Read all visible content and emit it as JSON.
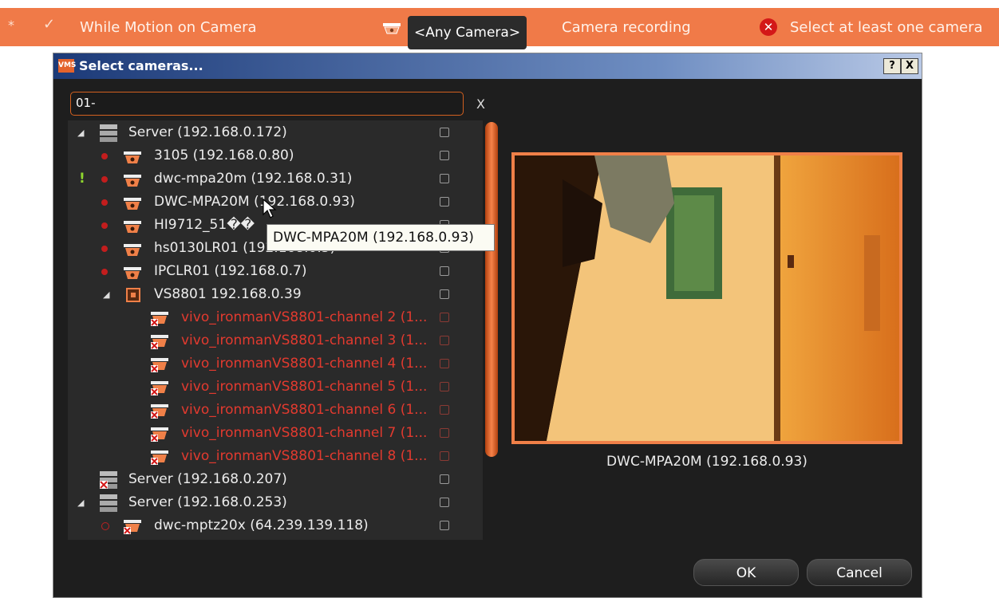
{
  "rule_bar": {
    "star": "*",
    "check": "✓",
    "condition": "While Motion on Camera",
    "camera_selector": "<Any Camera>",
    "action": "Camera recording",
    "error": "Select at least one camera"
  },
  "dialog": {
    "app_icon": "VMS",
    "title": "Select cameras...",
    "help_label": "?",
    "close_label": "X",
    "search_value": "01-",
    "clear_label": "X",
    "tree": [
      {
        "label": "Server (192.168.0.172)",
        "kind": "server"
      },
      {
        "label": "3105 (192.168.0.80)",
        "kind": "camera"
      },
      {
        "label": "dwc-mpa20m (192.168.0.31)",
        "kind": "camera"
      },
      {
        "label": "DWC-MPA20M (192.168.0.93)",
        "kind": "camera"
      },
      {
        "label": "HI9712_51��",
        "kind": "camera"
      },
      {
        "label": "hs0130LR01 (192.168.0.5)",
        "kind": "camera"
      },
      {
        "label": "IPCLR01 (192.168.0.7)",
        "kind": "camera"
      },
      {
        "label": "VS8801 192.168.0.39",
        "kind": "encoder"
      },
      {
        "label": "vivo_ironmanVS8801-channel 2 (1...",
        "kind": "channel"
      },
      {
        "label": "vivo_ironmanVS8801-channel 3 (1...",
        "kind": "channel"
      },
      {
        "label": "vivo_ironmanVS8801-channel 4 (1...",
        "kind": "channel"
      },
      {
        "label": "vivo_ironmanVS8801-channel 5 (1...",
        "kind": "channel"
      },
      {
        "label": "vivo_ironmanVS8801-channel 6 (1...",
        "kind": "channel"
      },
      {
        "label": "vivo_ironmanVS8801-channel 7 (1...",
        "kind": "channel"
      },
      {
        "label": "vivo_ironmanVS8801-channel 8 (1...",
        "kind": "channel"
      },
      {
        "label": "Server (192.168.0.207)",
        "kind": "server-offline"
      },
      {
        "label": "Server (192.168.0.253)",
        "kind": "server"
      },
      {
        "label": "dwc-mptz20x (64.239.139.118)",
        "kind": "camera-offline"
      }
    ],
    "tooltip": "DWC-MPA20M (192.168.0.93)",
    "preview_caption": "DWC-MPA20M (192.168.0.93)",
    "ok_label": "OK",
    "cancel_label": "Cancel"
  },
  "colors": {
    "accent": "#f07a48",
    "error": "#d31818",
    "offline_text": "#e23a2f"
  }
}
